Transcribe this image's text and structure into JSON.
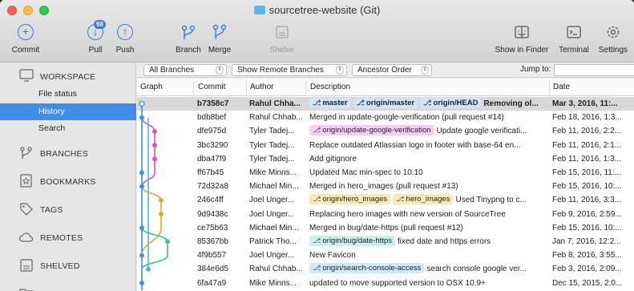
{
  "window": {
    "title": "sourcetree-website (Git)"
  },
  "toolbar": {
    "commit": "Commit",
    "pull": "Pull",
    "pull_badge": "98",
    "push": "Push",
    "branch": "Branch",
    "merge": "Merge",
    "shelve": "Shelve",
    "show_in_finder": "Show in Finder",
    "terminal": "Terminal",
    "settings": "Settings"
  },
  "sidebar": {
    "workspace": "WORKSPACE",
    "workspace_items": [
      "File status",
      "History",
      "Search"
    ],
    "branches": "BRANCHES",
    "bookmarks": "BOOKMARKS",
    "tags": "TAGS",
    "remotes": "REMOTES",
    "shelved": "SHELVED"
  },
  "filters": {
    "branches": "All Branches",
    "remote": "Show Remote Branches",
    "order": "Ancestor Order",
    "jump_label": "Jump to:"
  },
  "columns": {
    "graph": "Graph",
    "commit": "Commit",
    "author": "Author",
    "description": "Description",
    "date": "Date"
  },
  "commits": [
    {
      "hash": "b7358c7",
      "author": "Rahul Chha...",
      "refs": [
        {
          "name": "master",
          "color": "blue"
        },
        {
          "name": "origin/master",
          "color": "blue"
        },
        {
          "name": "origin/HEAD",
          "color": "blue"
        }
      ],
      "message": "Removing ol...",
      "date": "Mar 3, 2016, 11:..."
    },
    {
      "hash": "bdb8bef",
      "author": "Rahul Chhab...",
      "refs": [],
      "message": "Merged in update-google-verification (pull request #14)",
      "date": "Feb 18, 2016, 1:3..."
    },
    {
      "hash": "dfe975d",
      "author": "Tyler Tadej...",
      "refs": [
        {
          "name": "origin/update-google-verification",
          "color": "pink"
        }
      ],
      "message": "Update google verificati...",
      "date": "Feb 11, 2016, 2:2..."
    },
    {
      "hash": "3bc3290",
      "author": "Tyler Tadej...",
      "refs": [],
      "message": "Replace outdated Atlassian logo in footer with base-64 en...",
      "date": "Feb 11, 2016, 2:1..."
    },
    {
      "hash": "dba47f9",
      "author": "Tyler Tadej...",
      "refs": [],
      "message": "Add gitignore",
      "date": "Feb 11, 2016, 1:3..."
    },
    {
      "hash": "ff67b45",
      "author": "Mike Minns...",
      "refs": [],
      "message": "Updated Mac min-spec to 10.10",
      "date": "Feb 15, 2016, 11:..."
    },
    {
      "hash": "72d32a8",
      "author": "Michael Min...",
      "refs": [],
      "message": "Merged in hero_images (pull request #13)",
      "date": "Feb 15, 2016, 10:..."
    },
    {
      "hash": "246c4ff",
      "author": "Joel Unger...",
      "refs": [
        {
          "name": "origin/hero_images",
          "color": "yellow"
        },
        {
          "name": "hero_images",
          "color": "yellow"
        }
      ],
      "message": "Used Tinypng to c...",
      "date": "Feb 11, 2016, 3:3..."
    },
    {
      "hash": "9d9438c",
      "author": "Joel Unger...",
      "refs": [],
      "message": "Replacing hero images with new version of SourceTree",
      "date": "Feb 9, 2016, 2:59..."
    },
    {
      "hash": "ce75b63",
      "author": "Michael Min...",
      "refs": [],
      "message": "Merged in bug/date-https (pull request #12)",
      "date": "Feb 15, 2016, 10:..."
    },
    {
      "hash": "85367bb",
      "author": "Patrick Tho...",
      "refs": [
        {
          "name": "origin/bug/date-https",
          "color": "teal"
        }
      ],
      "message": "fixed date and https errors",
      "date": "Jan 7, 2016, 12:2..."
    },
    {
      "hash": "4f9b557",
      "author": "Joel Unger...",
      "refs": [],
      "message": "New Favicon",
      "date": "Feb 8, 2016, 3:55..."
    },
    {
      "hash": "384e6d5",
      "author": "Rahul Chhab...",
      "refs": [
        {
          "name": "origin/search-console-access",
          "color": "cyan"
        }
      ],
      "message": "search console google ver...",
      "date": "Feb 3, 2016, 2:09..."
    },
    {
      "hash": "6fa47a9",
      "author": "Mike Minns...",
      "refs": [],
      "message": "updated to move supported version to OSX 10.9+",
      "date": "Dec 15, 2015, 2:0..."
    }
  ],
  "colors": {
    "accent": "#3f8ee5",
    "graph_blue": "#3f8ee5",
    "graph_pink": "#d94fcf",
    "graph_cyan": "#4fb3e0",
    "graph_yellow": "#d9a93a",
    "graph_green": "#36c48a"
  }
}
